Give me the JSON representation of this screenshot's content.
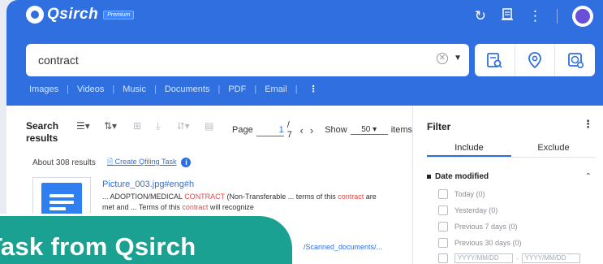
{
  "app": {
    "name": "Qsirch",
    "edition": "Premium"
  },
  "search": {
    "query": "contract"
  },
  "categories": [
    "Images",
    "Videos",
    "Music",
    "Documents",
    "PDF",
    "Email"
  ],
  "toolbar": {
    "title": "Search results",
    "page_label": "Page",
    "page_current": "1",
    "page_total": "/ 7",
    "show_label": "Show",
    "show_value": "50 ▾",
    "items_label": "items"
  },
  "summary": {
    "count_text": "About 308 results",
    "qfiling_link": "Create Qfiling Task"
  },
  "result": {
    "title": "Picture_003.jpg#eng#h",
    "snippet_pre": "... ADOPTION/MEDICAL ",
    "snippet_hl1": "CONTRACT",
    "snippet_mid": " (Non-Transferable ... terms of this ",
    "snippet_hl2": "contract",
    "snippet_mid2": " are met and ... Terms of this ",
    "snippet_hl3": "contract",
    "snippet_post": " will recognize",
    "path": "/Scanned_documents/..."
  },
  "banner": {
    "text": "Task from Qsirch"
  },
  "filter": {
    "title": "Filter",
    "tabs": [
      "Include",
      "Exclude"
    ],
    "active_tab": "Include",
    "section": "Date modified",
    "options": [
      "Today (0)",
      "Yesterday (0)",
      "Previous 7 days (0)",
      "Previous 30 days (0)"
    ],
    "date_from_placeholder": "YYYY/MM/DD",
    "date_to_placeholder": "YYYY/MM/DD",
    "date_separator": "-"
  },
  "colors": {
    "header": "#2f6fe0",
    "banner": "#1ba191",
    "highlight": "#e04848"
  }
}
